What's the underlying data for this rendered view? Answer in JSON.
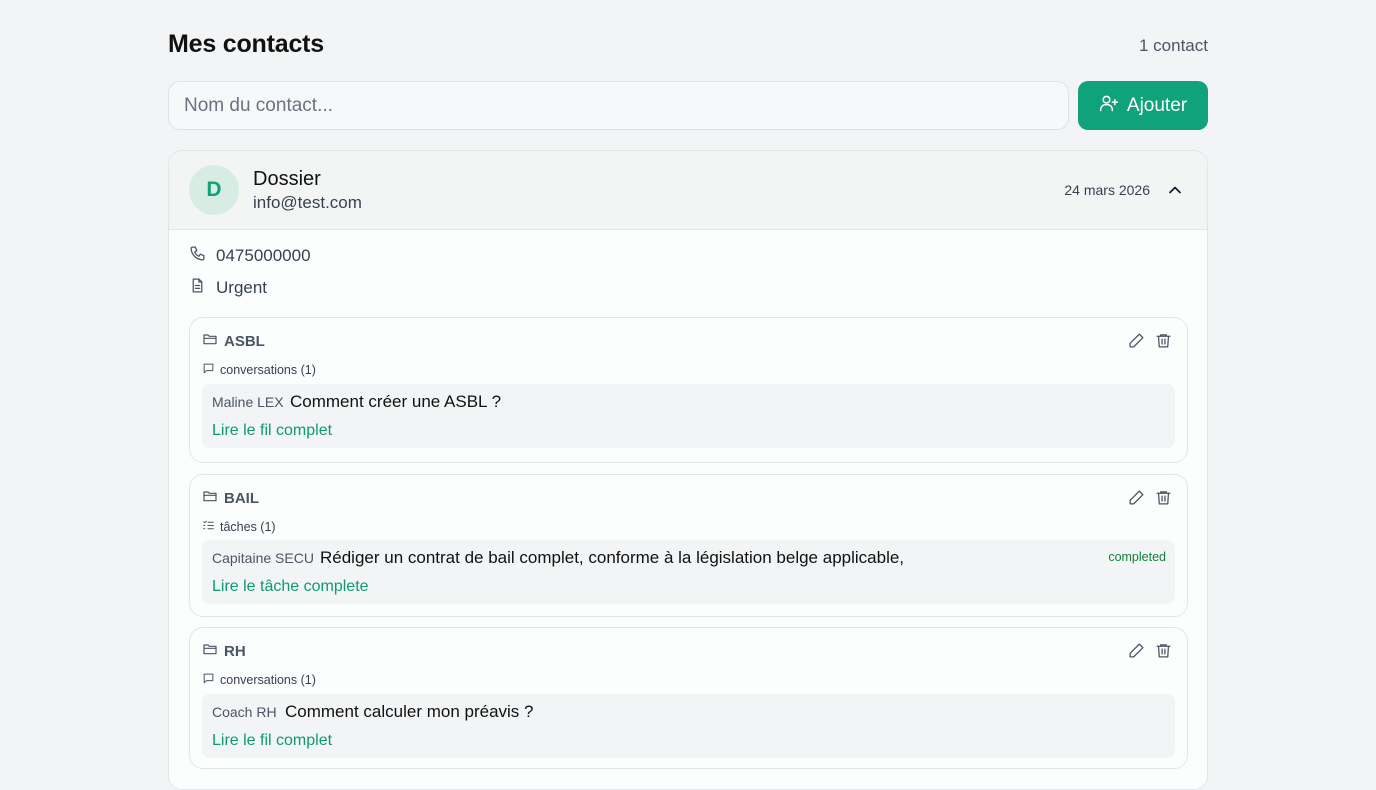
{
  "header": {
    "title": "Mes contacts",
    "count": "1 contact"
  },
  "search": {
    "placeholder": "Nom du contact..."
  },
  "add_button": {
    "label": "Ajouter",
    "icon": "user-plus-icon"
  },
  "contact": {
    "avatar_letter": "D",
    "name": "Dossier",
    "email": "info@test.com",
    "date": "24 mars 2026",
    "phone": "0475000000",
    "note": "Urgent"
  },
  "folders": [
    {
      "title": "ASBL",
      "section": "conversations (1)",
      "item": {
        "author": "Maline LEX",
        "text": "Comment créer une ASBL ?",
        "link": "Lire le fil complet"
      }
    },
    {
      "title": "BAIL",
      "section": "tâches (1)",
      "item": {
        "author": "Capitaine SECU",
        "text": "Rédiger un contrat de bail complet, conforme à la législation belge applicable,",
        "link": "Lire le tâche complete",
        "status": "completed"
      }
    },
    {
      "title": "RH",
      "section": "conversations (1)",
      "item": {
        "author": "Coach RH",
        "text": "Comment calculer mon préavis ?",
        "link": "Lire le fil complet"
      }
    }
  ],
  "colors": {
    "accent": "#10a27a",
    "link": "#0f9a6f",
    "status_completed": "#15803d"
  }
}
